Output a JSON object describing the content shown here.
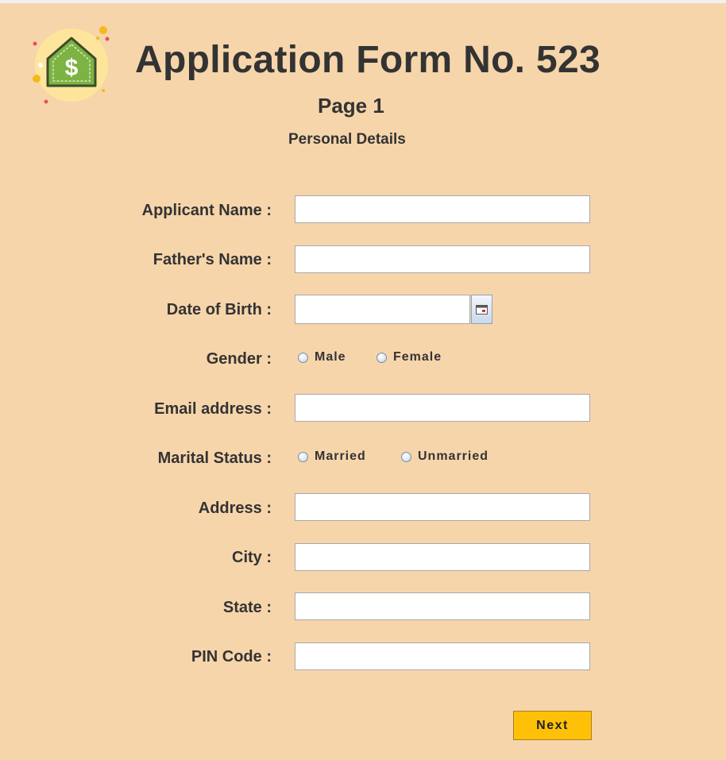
{
  "header": {
    "title": "Application Form No. 523",
    "page": "Page 1",
    "section": "Personal Details",
    "logo_icon": "house-dollar-icon"
  },
  "fields": {
    "applicant_name": {
      "label": "Applicant Name :",
      "value": ""
    },
    "fathers_name": {
      "label": "Father's Name :",
      "value": ""
    },
    "dob": {
      "label": "Date of Birth :",
      "value": "",
      "button_icon": "calendar-icon"
    },
    "gender": {
      "label": "Gender :",
      "options": [
        "Male",
        "Female"
      ],
      "selected": null
    },
    "email": {
      "label": "Email address :",
      "value": ""
    },
    "marital_status": {
      "label": "Marital Status :",
      "options": [
        "Married",
        "Unmarried"
      ],
      "selected": null
    },
    "address": {
      "label": "Address :",
      "value": ""
    },
    "city": {
      "label": "City :",
      "value": ""
    },
    "state": {
      "label": "State :",
      "value": ""
    },
    "pin_code": {
      "label": "PIN Code :",
      "value": ""
    }
  },
  "actions": {
    "next_label": "Next"
  },
  "colors": {
    "background": "#f7d5ab",
    "title_text": "#333333",
    "next_button": "#ffc107",
    "logo_green": "#7cb342",
    "logo_circle": "#fde59b"
  }
}
